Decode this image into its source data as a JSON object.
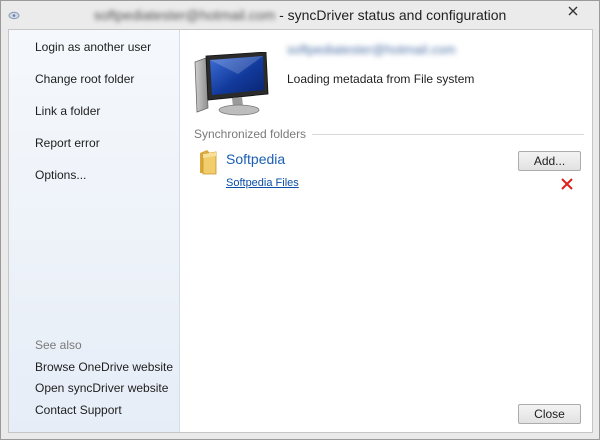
{
  "window": {
    "title_blurred": "softpediatester@hotmail.com",
    "title_suffix": " - syncDriver status and configuration"
  },
  "sidebar": {
    "actions": [
      {
        "label": "Login as another user"
      },
      {
        "label": "Change root folder"
      },
      {
        "label": "Link a folder"
      },
      {
        "label": "Report error"
      },
      {
        "label": "Options..."
      }
    ],
    "see_also_label": "See also",
    "see_also": [
      {
        "label": "Browse OneDrive website"
      },
      {
        "label": "Open syncDriver website"
      },
      {
        "label": "Contact Support"
      }
    ]
  },
  "account": {
    "email_blurred": "softpediatester@hotmail.com",
    "status": "Loading metadata from File system"
  },
  "sync": {
    "heading": "Synchronized folders",
    "add_label": "Add...",
    "folders": [
      {
        "name": "Softpedia",
        "link": "Softpedia Files"
      }
    ]
  },
  "footer": {
    "close_label": "Close"
  },
  "icons": {
    "app": "app-icon",
    "close": "close-icon",
    "monitor": "computer-monitor-icon",
    "folder": "folder-icon",
    "remove": "remove-icon"
  },
  "colors": {
    "accent_blue": "#1a5fb4",
    "remove_red": "#e0201b",
    "sidebar_bg": "#edf2f9"
  }
}
